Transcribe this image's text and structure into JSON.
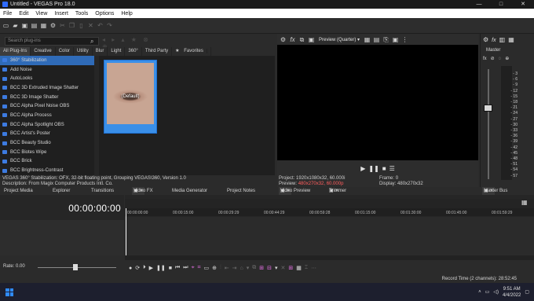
{
  "window": {
    "title": "Untitled - VEGAS Pro 18.0",
    "controls": [
      "—",
      "□",
      "✕"
    ]
  },
  "menu": [
    "File",
    "Edit",
    "View",
    "Insert",
    "Tools",
    "Options",
    "Help"
  ],
  "plugins": {
    "search_placeholder": "Search plug-ins",
    "categories": [
      "All Plug-Ins",
      "Creative",
      "Color",
      "Utility",
      "Blur",
      "Light",
      "360°",
      "Third Party",
      "Favorites"
    ],
    "items": [
      "360° Stabilization",
      "Add Noise",
      "AutoLooks",
      "BCC 3D Extruded Image Shatter",
      "BCC 3D Image Shatter",
      "BCC Alpha Pixel Noise OBS",
      "BCC Alpha Process",
      "BCC Alpha Spotlight OBS",
      "BCC Artist's Poster",
      "BCC Beauty Studio",
      "BCC Biotes Wipe",
      "BCC Brick",
      "BCC Brightness-Contrast"
    ],
    "preset_label": "(Default)",
    "description_line1": "VEGAS 360° Stabilization: OFX, 32-bit floating point, Grouping VEGAS\\360, Version 1.0",
    "description_line2": "Description: From Magix Computer Products Intl. Co."
  },
  "preview": {
    "quality": "Preview (Quarter)",
    "project_label": "Project:",
    "project_value": "1920x1080x32, 60.000i",
    "preview_label": "Preview:",
    "preview_value": "480x270x32, 60.000p",
    "frame_label": "Frame:",
    "frame_value": "0",
    "display_label": "Display:",
    "display_value": "480x270x32"
  },
  "mixer": {
    "master_label": "Master",
    "fx_label": "fx",
    "meter_ticks": [
      "3",
      "6",
      "9",
      "12",
      "15",
      "18",
      "21",
      "24",
      "27",
      "30",
      "33",
      "36",
      "39",
      "42",
      "45",
      "48",
      "51",
      "54",
      "57"
    ]
  },
  "tabs": {
    "project_media": "Project Media",
    "explorer": "Explorer",
    "transitions": "Transitions",
    "video_fx": "Video FX",
    "media_generator": "Media Generator",
    "project_notes": "Project Notes",
    "video_preview": "Video Preview",
    "trimmer": "Trimmer",
    "master_bus": "Master Bus"
  },
  "timeline": {
    "timecode": "00:00:00:00",
    "ruler": [
      "00:00:00:00",
      "00:00:15:00",
      "00:00:29:29",
      "00:00:44:29",
      "00:00:59:28",
      "00:01:15:00",
      "00:01:30:00",
      "00:01:45:00",
      "00:01:59:29"
    ],
    "rate_label": "Rate: 0.00"
  },
  "status": {
    "record_time": "Record Time (2 channels): 28:52:45"
  },
  "taskbar": {
    "time": "9:51 AM",
    "date": "4/4/2022"
  }
}
